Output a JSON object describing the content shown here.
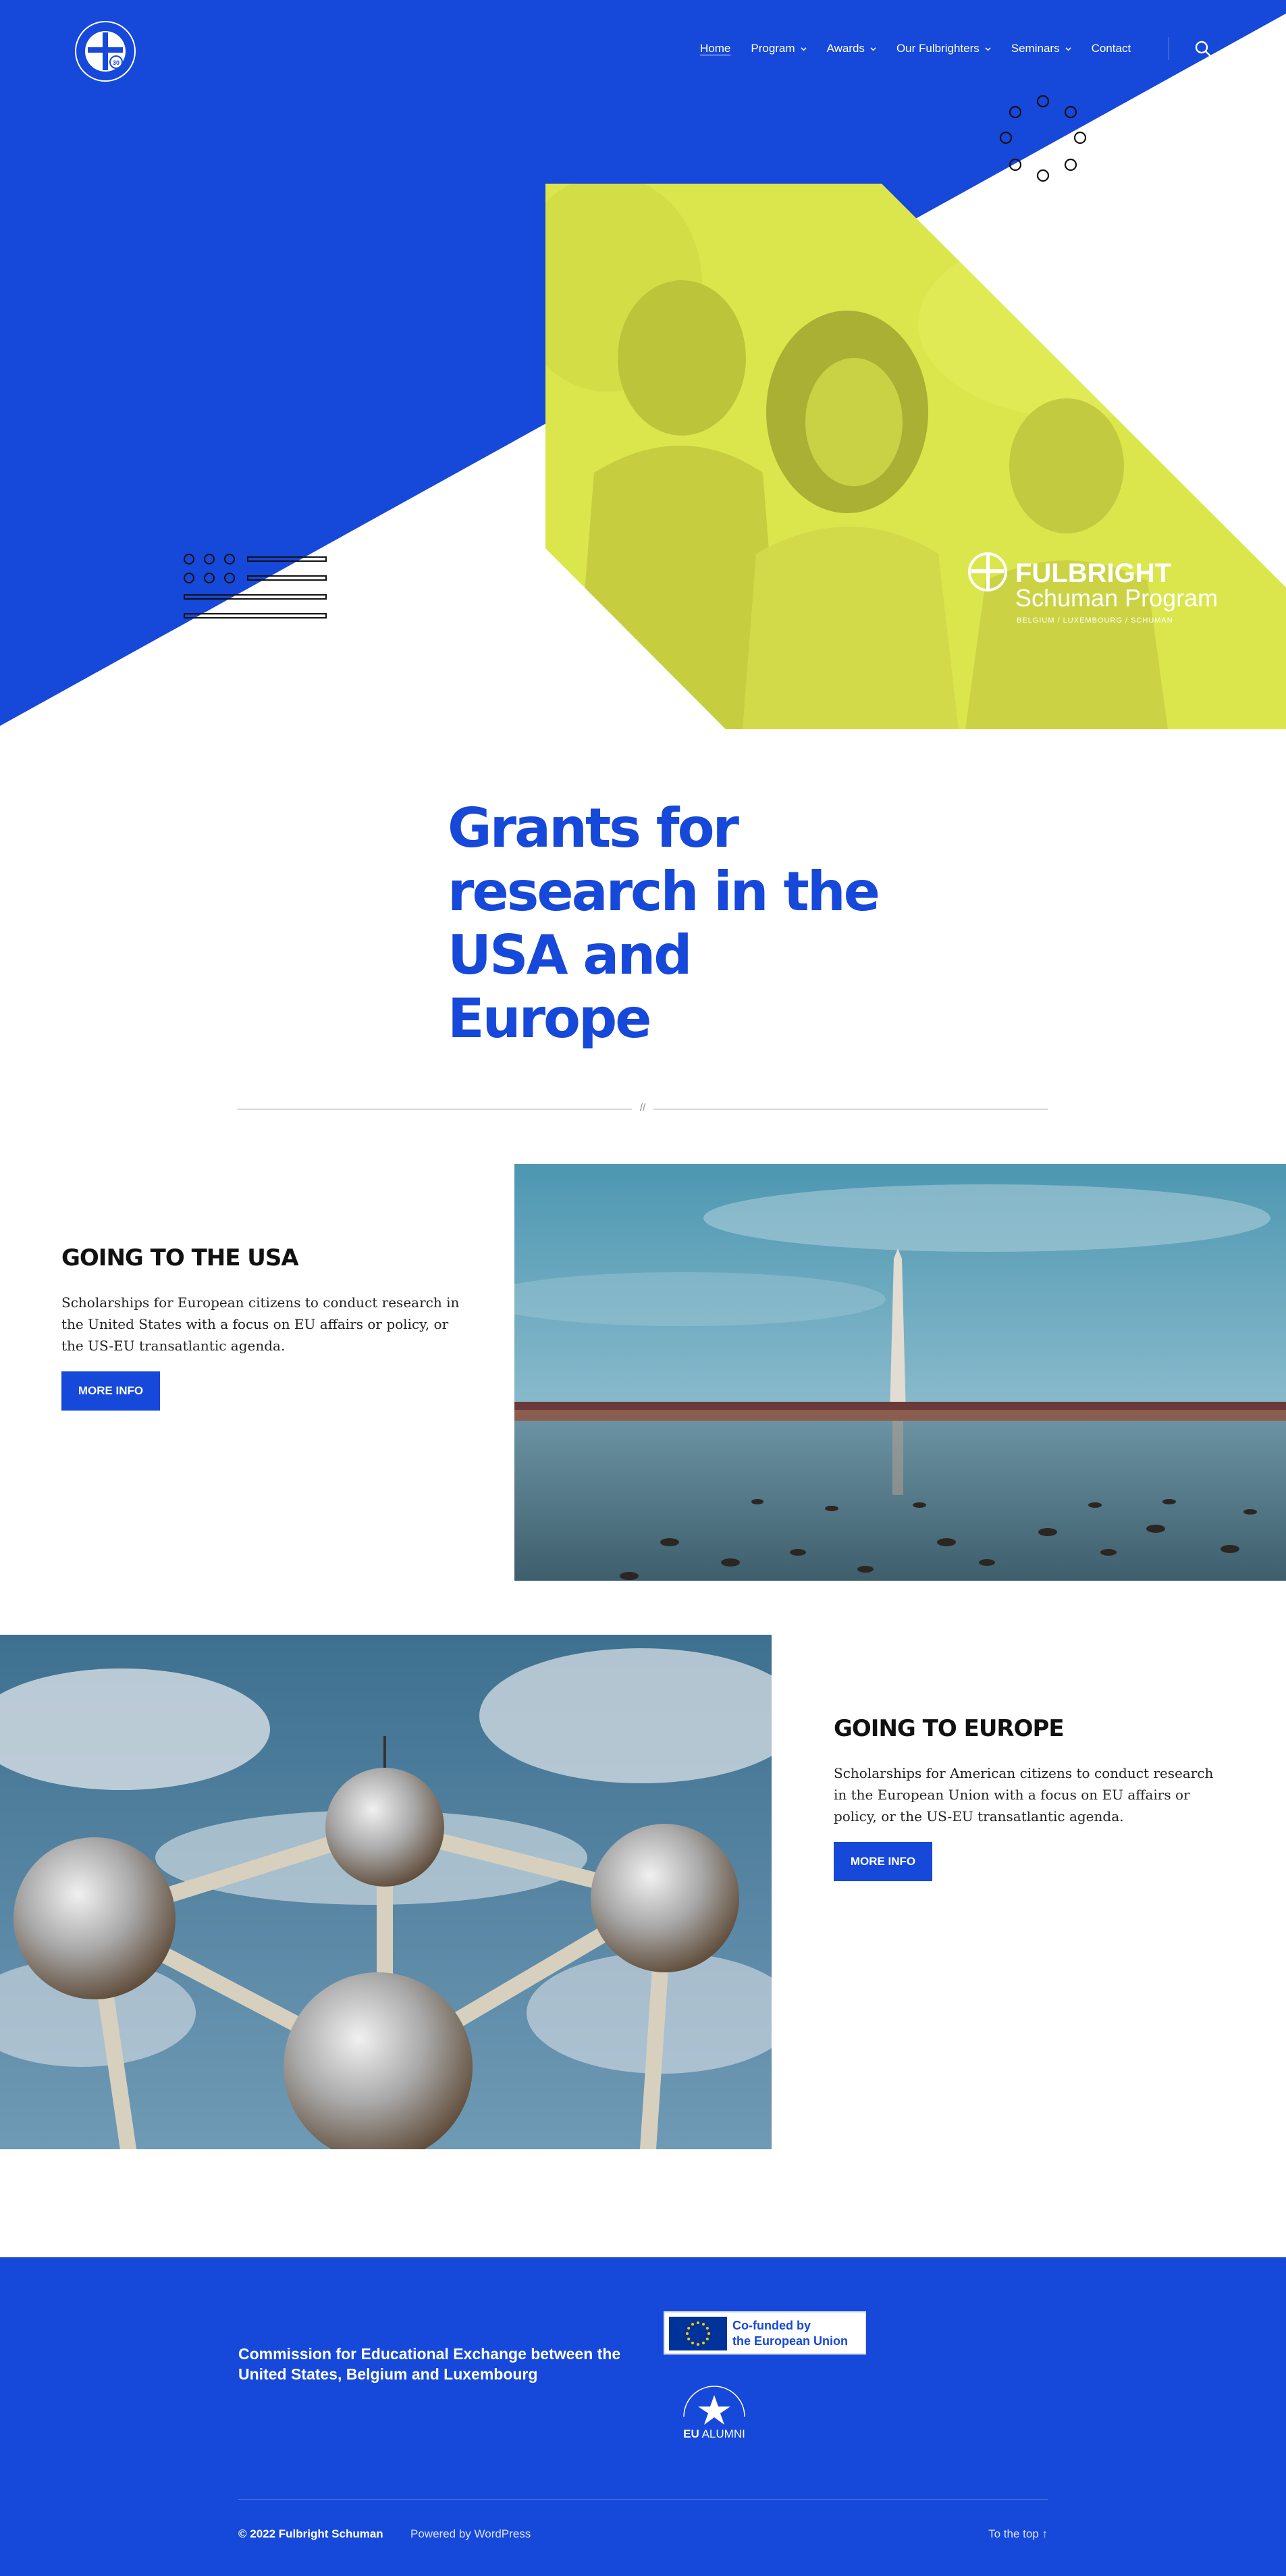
{
  "site": {
    "logo_alt": "Fulbright Schuman 30th anniversary logo"
  },
  "nav": {
    "items": [
      {
        "label": "Home",
        "dropdown": false,
        "current": true
      },
      {
        "label": "Program",
        "dropdown": true,
        "current": false
      },
      {
        "label": "Awards",
        "dropdown": true,
        "current": false
      },
      {
        "label": "Our Fulbrighters",
        "dropdown": true,
        "current": false
      },
      {
        "label": "Seminars",
        "dropdown": true,
        "current": false
      },
      {
        "label": "Contact",
        "dropdown": false,
        "current": false
      }
    ],
    "search_icon": "search-icon"
  },
  "hero": {
    "brand_line1": "FULBRIGHT",
    "brand_line2": "Schuman Program",
    "brand_line3": "BELGIUM / LUXEMBOURG / SCHUMAN"
  },
  "heading": {
    "title": "Grants for research in the USA and Europe"
  },
  "divider": {
    "mark": "//"
  },
  "sections": {
    "usa": {
      "title": "GOING TO THE USA",
      "text": "Scholarships for European citizens to conduct research in the United States with a focus on EU affairs or policy, or the US-EU transatlantic agenda.",
      "button": "MORE INFO"
    },
    "europe": {
      "title": "GOING TO EUROPE",
      "text": "Scholarships for American citizens to conduct research in the European Union with a focus on EU affairs or policy, or the US-EU transatlantic agenda.",
      "button": "MORE INFO"
    }
  },
  "footer": {
    "commission": "Commission for Educational Exchange between the United States, Belgium and Luxembourg",
    "eu_line1": "Co-funded by",
    "eu_line2": "the European Union",
    "alumni_bold": "EU",
    "alumni_text": "ALUMNI",
    "copyright": "© 2022 Fulbright Schuman",
    "powered": "Powered by WordPress",
    "to_top": "To the top ↑"
  },
  "colors": {
    "brand_blue": "#1648d9",
    "lime": "#dde84a",
    "white": "#ffffff"
  }
}
